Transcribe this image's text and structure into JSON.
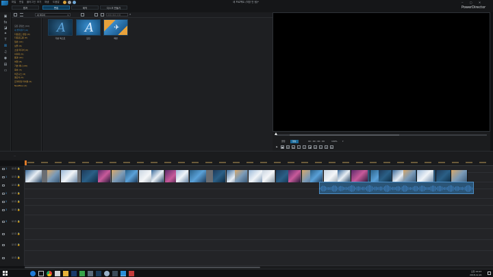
{
  "titlebar": {
    "title": "새 프로젝트 (저장 안 됨)*",
    "app_name": "PowerDirector",
    "win_controls": [
      "‒",
      "▢",
      "✕"
    ]
  },
  "menu": [
    "파일",
    "편집",
    "플러그인",
    "보기",
    "재생",
    "도움말"
  ],
  "tabs": [
    {
      "label": "캡쳐",
      "active": false
    },
    {
      "label": "편집",
      "active": true
    },
    {
      "label": "제작",
      "active": false
    },
    {
      "label": "디스크 만들기",
      "active": false
    }
  ],
  "library": {
    "dropdown": "내 미디어",
    "search_placeholder": "라이브러리 검색",
    "categories": [
      {
        "label": "모든 콘텐츠 (19)",
        "style": "normal"
      },
      {
        "label": "내 즐겨찾기 (0)",
        "style": "blue"
      },
      {
        "label": "다운로드 편집 (0)",
        "style": "yellow"
      },
      {
        "label": "다운로드됨 (0)",
        "style": "yellow"
      },
      {
        "label": "일반 (12)",
        "style": "yellow"
      },
      {
        "label": "심플 (6)",
        "style": "yellow"
      },
      {
        "label": "소셜 미디어 (0)",
        "style": "yellow"
      },
      {
        "label": "이미지 (5)",
        "style": "yellow"
      },
      {
        "label": "풍경 (10)",
        "style": "yellow"
      },
      {
        "label": "여행 (8)",
        "style": "yellow"
      },
      {
        "label": "기본 애니 (20)",
        "style": "yellow"
      },
      {
        "label": "축하 (3)",
        "style": "yellow"
      },
      {
        "label": "비즈니스 (4)",
        "style": "yellow"
      },
      {
        "label": "결혼식 (5)",
        "style": "yellow"
      },
      {
        "label": "프리미엄 타이틀 (5)",
        "style": "yellow"
      },
      {
        "label": "NewBlue (4)",
        "style": "yellow"
      }
    ],
    "items": [
      {
        "label": "기본 텍스트",
        "kind": "title-a"
      },
      {
        "label": "모던",
        "kind": "title-a-light"
      },
      {
        "label": "해변",
        "kind": "beach"
      }
    ]
  },
  "preview": {
    "mode_labels": [
      "클립",
      "영상"
    ],
    "timecode": "00 ; 00 ; 00 ; 00",
    "zoom": "100%"
  },
  "timeline": {
    "track_numbers": [
      "1",
      "1",
      "",
      "2",
      "2",
      "3",
      "3",
      "",
      ""
    ],
    "clip_count": 18
  },
  "taskbar": {
    "time": "오전 12:03",
    "date": "2018-12-20"
  },
  "colors": {
    "accent": "#2a8fd8",
    "category_text": "#d8a23a",
    "audio_wave": "#3d7fbf",
    "selected_clip_bg": "#2a5476"
  }
}
